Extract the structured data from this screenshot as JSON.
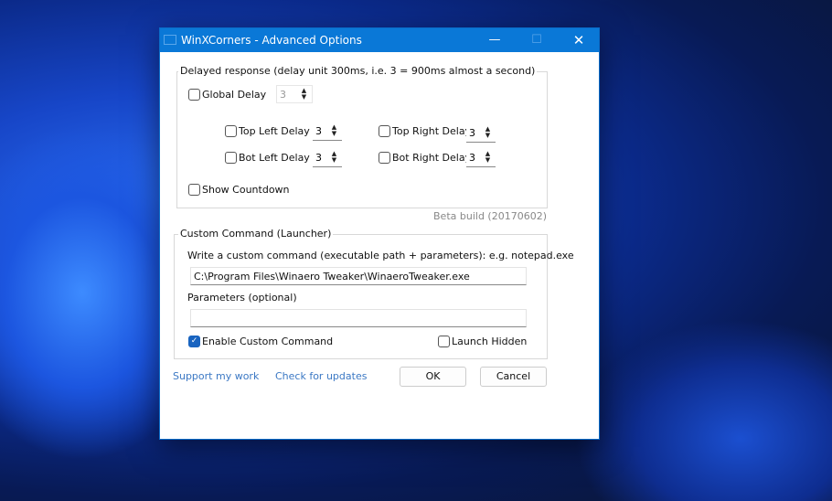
{
  "window": {
    "title": "WinXCorners - Advanced Options",
    "minimize": "—",
    "maximize": "☐",
    "close": "✕"
  },
  "delay_group": {
    "legend": "Delayed response (delay unit 300ms, i.e. 3 = 900ms almost a second)",
    "global": {
      "label": "Global Delay",
      "checked": false,
      "value": "3",
      "disabled": true
    },
    "top_left": {
      "label": "Top Left Delay",
      "checked": false,
      "value": "3"
    },
    "top_right": {
      "label": "Top Right Delay",
      "checked": false,
      "value": "3"
    },
    "bot_left": {
      "label": "Bot Left Delay",
      "checked": false,
      "value": "3"
    },
    "bot_right": {
      "label": "Bot Right Delay",
      "checked": false,
      "value": "3"
    },
    "show_countdown": {
      "label": "Show Countdown",
      "checked": false
    }
  },
  "build": "Beta build (20170602)",
  "command_group": {
    "legend": "Custom Command (Launcher)",
    "command_label": "Write a custom command (executable path + parameters): e.g. notepad.exe",
    "command_value": "C:\\Program Files\\Winaero Tweaker\\WinaeroTweaker.exe",
    "params_label": "Parameters (optional)",
    "params_value": "",
    "enable": {
      "label": "Enable Custom Command",
      "checked": true,
      "mark": "✓"
    },
    "launch_hidden": {
      "label": "Launch Hidden",
      "checked": false
    }
  },
  "footer": {
    "support": "Support my work",
    "updates": "Check for updates",
    "ok": "OK",
    "cancel": "Cancel"
  },
  "spin_arrows": "▲\n▼"
}
